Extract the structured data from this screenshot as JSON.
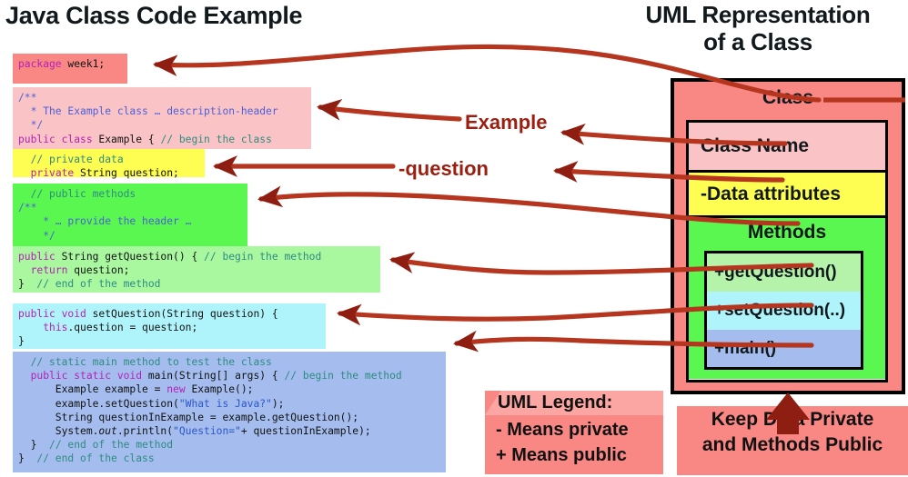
{
  "titles": {
    "left": "Java Class Code Example",
    "right_line1": "UML Representation",
    "right_line2": "of a Class"
  },
  "code_blocks": [
    {
      "name": "package",
      "color": "#f98784",
      "lines": [
        "package week1;"
      ]
    },
    {
      "name": "class-header",
      "color": "#fac4c6",
      "lines": [
        "/**",
        "  * The Example class … description-header",
        "  */",
        "public class Example { // begin the class"
      ]
    },
    {
      "name": "private-data",
      "color": "#fdfd52",
      "lines": [
        "  // private data",
        "  private String question;"
      ]
    },
    {
      "name": "method-comment",
      "color": "#5bf751",
      "lines": [
        "  // public methods",
        "/**",
        "    * … provide the header …",
        "    */"
      ]
    },
    {
      "name": "get-question",
      "color": "#a9f8a0",
      "lines": [
        "public String getQuestion() { // begin the method",
        "  return question;",
        "}  // end of the method"
      ]
    },
    {
      "name": "set-question",
      "color": "#b0f4fb",
      "lines": [
        "public void setQuestion(String question) {",
        "    this.question = question;",
        "}"
      ]
    },
    {
      "name": "main-method",
      "color": "#a4bdee",
      "lines": [
        "  // static main method to test the class",
        "  public static void main(String[] args) { // begin the method",
        "      Example example = new Example();",
        "      example.setQuestion(\"What is Java?\");",
        "      String questionInExample = example.getQuestion();",
        "      System.out.println(\"Question=\"+ questionInExample);",
        "  }  // end of the method",
        "}  // end of the class"
      ]
    }
  ],
  "mid_labels": {
    "example": "Example",
    "question": "-question"
  },
  "uml": {
    "class_label": "Class",
    "class_name": "Class Name",
    "data_attributes": "-Data attributes",
    "methods_title": "Methods",
    "methods": [
      "+getQuestion()",
      "+setQuestion(..)",
      "+main()"
    ],
    "colors": {
      "outer": "#f98784",
      "class_name": "#fac4c6",
      "data": "#fdfd52",
      "methods": "#5bf751",
      "get": "#b5f3ab",
      "set": "#b0f4fb",
      "main": "#a4bdee"
    }
  },
  "legend": {
    "title": "UML Legend:",
    "private": "- Means private",
    "public": "+ Means public"
  },
  "banner": {
    "line1": "Keep Data Private",
    "line2": "and Methods Public"
  },
  "arrow_color": "#b5351f",
  "arrow_up_color": "#8f1e12"
}
